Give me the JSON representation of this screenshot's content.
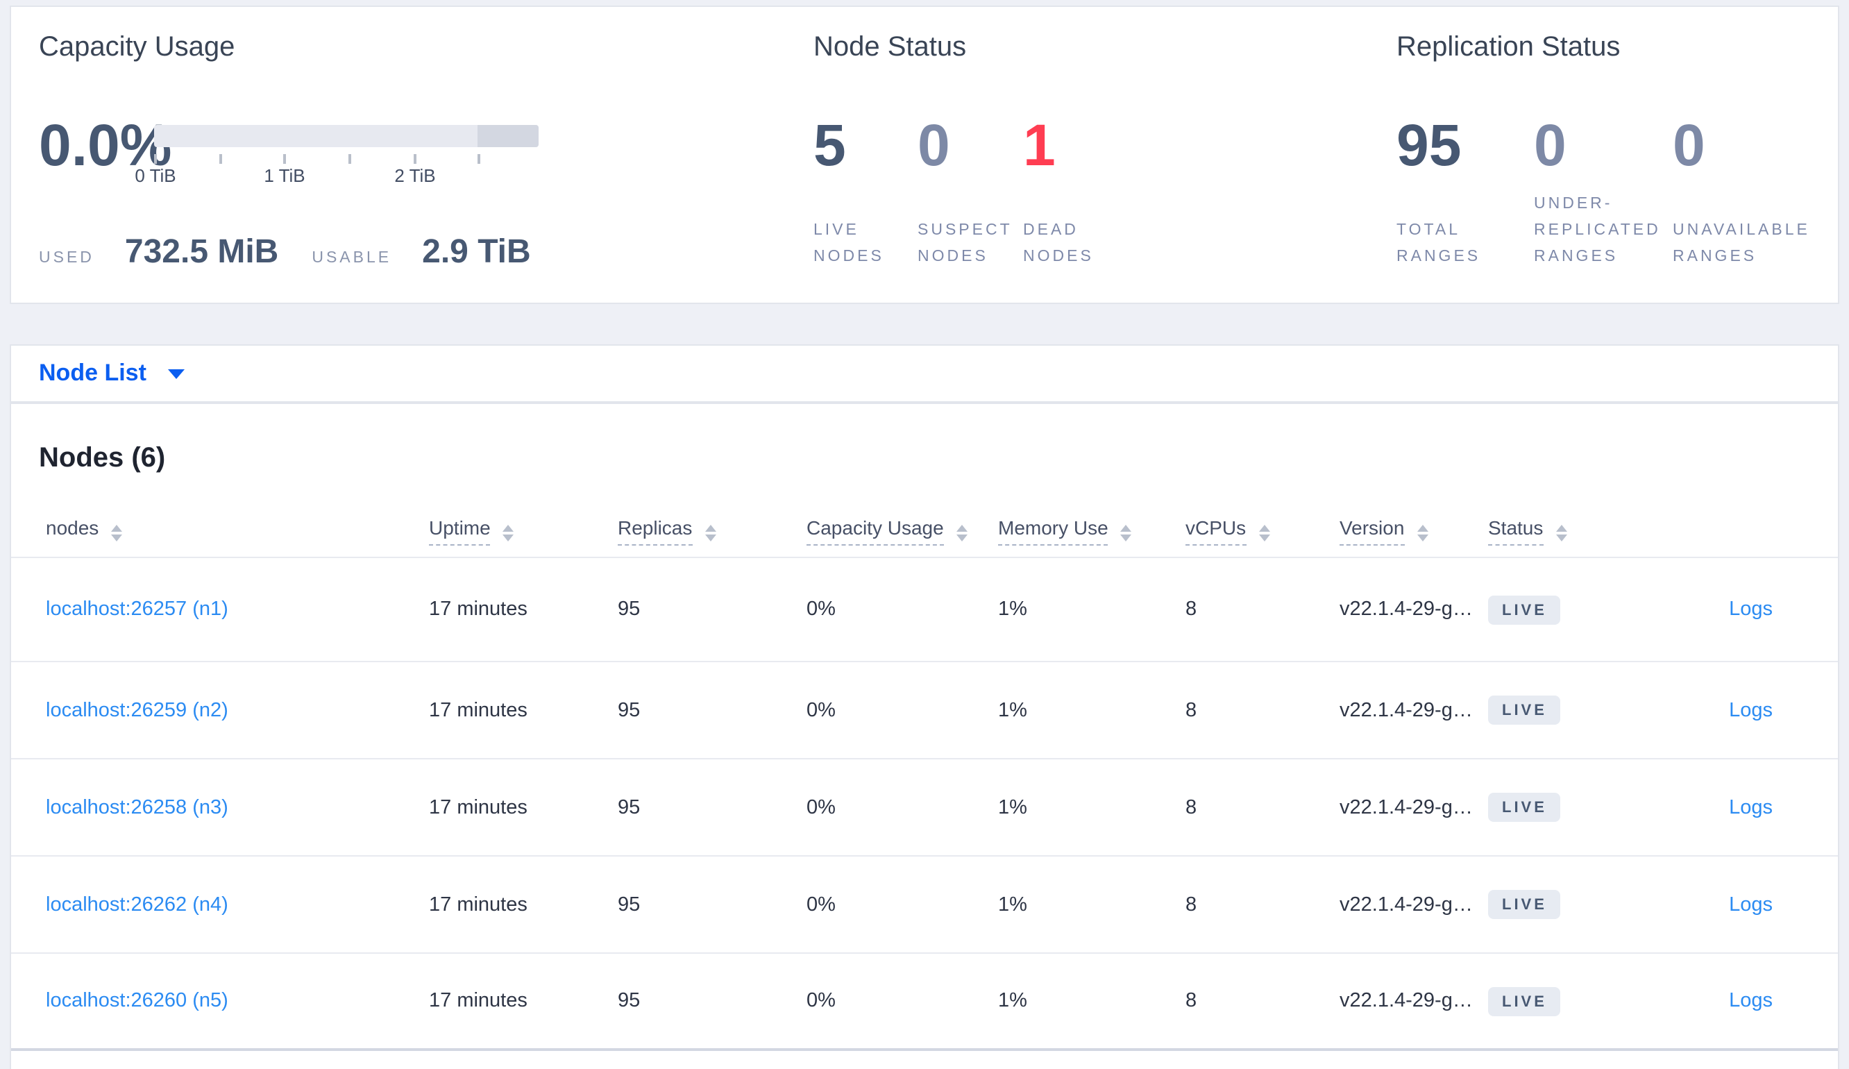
{
  "capacity_usage": {
    "title": "Capacity Usage",
    "percent": "0.0%",
    "ticks": [
      "0 TiB",
      "1 TiB",
      "2 TiB"
    ],
    "used_label": "USED",
    "used_value": "732.5 MiB",
    "usable_label": "USABLE",
    "usable_value": "2.9 TiB"
  },
  "node_status": {
    "title": "Node Status",
    "stats": [
      {
        "value": "5",
        "line1": "LIVE",
        "line2": "NODES"
      },
      {
        "value": "0",
        "line1": "SUSPECT",
        "line2": "NODES"
      },
      {
        "value": "1",
        "line1": "DEAD",
        "line2": "NODES"
      }
    ]
  },
  "replication_status": {
    "title": "Replication Status",
    "stats": [
      {
        "value": "95",
        "line1": "TOTAL",
        "line2": "RANGES"
      },
      {
        "value": "0",
        "line0": "UNDER-",
        "line1": "REPLICATED",
        "line2": "RANGES"
      },
      {
        "value": "0",
        "line1": "UNAVAILABLE",
        "line2": "RANGES"
      }
    ]
  },
  "node_list": {
    "label": "Node List"
  },
  "nodes_section": {
    "title": "Nodes (6)",
    "columns": [
      {
        "label": "nodes"
      },
      {
        "label": "Uptime"
      },
      {
        "label": "Replicas"
      },
      {
        "label": "Capacity Usage"
      },
      {
        "label": "Memory Use"
      },
      {
        "label": "vCPUs"
      },
      {
        "label": "Version"
      },
      {
        "label": "Status"
      }
    ],
    "rows": [
      {
        "node": "localhost:26257 (n1)",
        "uptime": "17 minutes",
        "replicas": "95",
        "capacity": "0%",
        "memory": "1%",
        "vcpus": "8",
        "version": "v22.1.4-29-g…",
        "status": "LIVE",
        "logs": "Logs"
      },
      {
        "node": "localhost:26259 (n2)",
        "uptime": "17 minutes",
        "replicas": "95",
        "capacity": "0%",
        "memory": "1%",
        "vcpus": "8",
        "version": "v22.1.4-29-g…",
        "status": "LIVE",
        "logs": "Logs"
      },
      {
        "node": "localhost:26258 (n3)",
        "uptime": "17 minutes",
        "replicas": "95",
        "capacity": "0%",
        "memory": "1%",
        "vcpus": "8",
        "version": "v22.1.4-29-g…",
        "status": "LIVE",
        "logs": "Logs"
      },
      {
        "node": "localhost:26262 (n4)",
        "uptime": "17 minutes",
        "replicas": "95",
        "capacity": "0%",
        "memory": "1%",
        "vcpus": "8",
        "version": "v22.1.4-29-g…",
        "status": "LIVE",
        "logs": "Logs"
      },
      {
        "node": "localhost:26260 (n5)",
        "uptime": "17 minutes",
        "replicas": "95",
        "capacity": "0%",
        "memory": "1%",
        "vcpus": "8",
        "version": "v22.1.4-29-g…",
        "status": "LIVE",
        "logs": "Logs"
      }
    ]
  },
  "colors": {
    "accent_blue": "#0b5ef0",
    "link_blue": "#2b8bf2",
    "danger_red": "#ff3d52",
    "stat_dark": "#475872"
  }
}
